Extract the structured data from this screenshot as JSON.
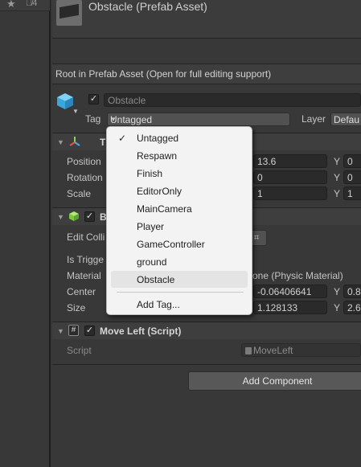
{
  "hierarchy_strip": {
    "visibility_count": "4"
  },
  "prefab": {
    "title": "Obstacle (Prefab Asset)"
  },
  "root_bar": {
    "text": "Root in Prefab Asset (Open for full editing support)"
  },
  "gameobject": {
    "name": "Obstacle",
    "tag_label": "Tag",
    "tag_value": "Untagged",
    "layer_label": "Layer",
    "layer_value": "Defau"
  },
  "transform": {
    "title": "T",
    "rows": [
      {
        "label": "Position",
        "x": "13.6",
        "y": "0"
      },
      {
        "label": "Rotation",
        "x": "0",
        "y": "0"
      },
      {
        "label": "Scale",
        "x": "1",
        "y": "1"
      }
    ]
  },
  "box_collider": {
    "title": "B",
    "edit_label": "Edit Colli",
    "trigger_label": "Is Trigge",
    "material_label": "Material",
    "material_value": "one (Physic Material)",
    "center_label": "Center",
    "center_x": "-0.06406641",
    "center_y": "0.8",
    "size_label": "Size",
    "size_x": "1.128133",
    "size_y": "2.6"
  },
  "move_left": {
    "title": "Move Left (Script)",
    "script_label": "Script",
    "script_value": "MoveLeft"
  },
  "add_component_label": "Add Component",
  "axis_labels": {
    "y": "Y"
  },
  "tag_dropdown": {
    "selected": "Untagged",
    "highlighted": "Obstacle",
    "items": [
      "Untagged",
      "Respawn",
      "Finish",
      "EditorOnly",
      "MainCamera",
      "Player",
      "GameController",
      "ground",
      "Obstacle"
    ],
    "add_tag": "Add Tag..."
  },
  "colors": {
    "panel": "#383838",
    "dropdown_bg": "#f3f3f3",
    "cube_icon": "#4fb3e8",
    "collider_icon": "#8bd34f"
  }
}
